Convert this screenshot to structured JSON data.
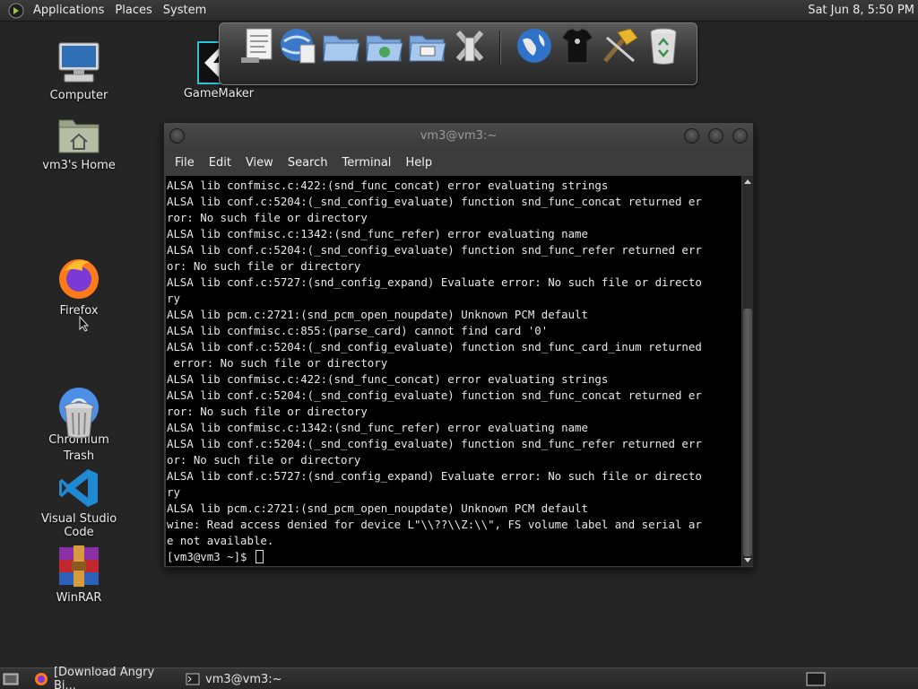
{
  "top_panel": {
    "menus": [
      "Applications",
      "Places",
      "System"
    ],
    "clock": "Sat Jun  8,  5:50 PM"
  },
  "desktop": {
    "icons": [
      {
        "label": "Computer",
        "icon": "computer-icon"
      },
      {
        "label": "vm3's Home",
        "icon": "home-folder-icon"
      },
      {
        "label": "Firefox",
        "icon": "firefox-icon"
      },
      {
        "label": "Chromium",
        "icon": "chromium-icon"
      },
      {
        "label": "Trash",
        "icon": "trash-icon"
      },
      {
        "label": "Visual Studio Code",
        "icon": "vscode-icon"
      },
      {
        "label": "WinRAR",
        "icon": "winrar-icon"
      },
      {
        "label": "GameMaker",
        "icon": "gamemaker-icon"
      }
    ]
  },
  "dock": {
    "items": [
      "text-editor-icon",
      "web-browser-icon",
      "file-manager-icon",
      "network-folder-icon",
      "image-folder-icon",
      "system-tools-icon",
      "web-globe-icon",
      "tshirt-icon",
      "hammer-icon",
      "recycle-bin-icon"
    ]
  },
  "terminal": {
    "title": "vm3@vm3:~",
    "menus": [
      "File",
      "Edit",
      "View",
      "Search",
      "Terminal",
      "Help"
    ],
    "lines": [
      "ALSA lib confmisc.c:422:(snd_func_concat) error evaluating strings",
      "ALSA lib conf.c:5204:(_snd_config_evaluate) function snd_func_concat returned er",
      "ror: No such file or directory",
      "ALSA lib confmisc.c:1342:(snd_func_refer) error evaluating name",
      "ALSA lib conf.c:5204:(_snd_config_evaluate) function snd_func_refer returned err",
      "or: No such file or directory",
      "ALSA lib conf.c:5727:(snd_config_expand) Evaluate error: No such file or directo",
      "ry",
      "ALSA lib pcm.c:2721:(snd_pcm_open_noupdate) Unknown PCM default",
      "ALSA lib confmisc.c:855:(parse_card) cannot find card '0'",
      "ALSA lib conf.c:5204:(_snd_config_evaluate) function snd_func_card_inum returned",
      " error: No such file or directory",
      "ALSA lib confmisc.c:422:(snd_func_concat) error evaluating strings",
      "ALSA lib conf.c:5204:(_snd_config_evaluate) function snd_func_concat returned er",
      "ror: No such file or directory",
      "ALSA lib confmisc.c:1342:(snd_func_refer) error evaluating name",
      "ALSA lib conf.c:5204:(_snd_config_evaluate) function snd_func_refer returned err",
      "or: No such file or directory",
      "ALSA lib conf.c:5727:(snd_config_expand) Evaluate error: No such file or directo",
      "ry",
      "ALSA lib pcm.c:2721:(snd_pcm_open_noupdate) Unknown PCM default",
      "wine: Read access denied for device L\"\\\\??\\\\Z:\\\\\", FS volume label and serial ar",
      "e not available."
    ],
    "prompt": "[vm3@vm3 ~]$ "
  },
  "taskbar": {
    "tasks": [
      {
        "label": "[Download Angry Bi...",
        "icon": "firefox-icon"
      },
      {
        "label": "vm3@vm3:~",
        "icon": "terminal-icon"
      }
    ]
  }
}
